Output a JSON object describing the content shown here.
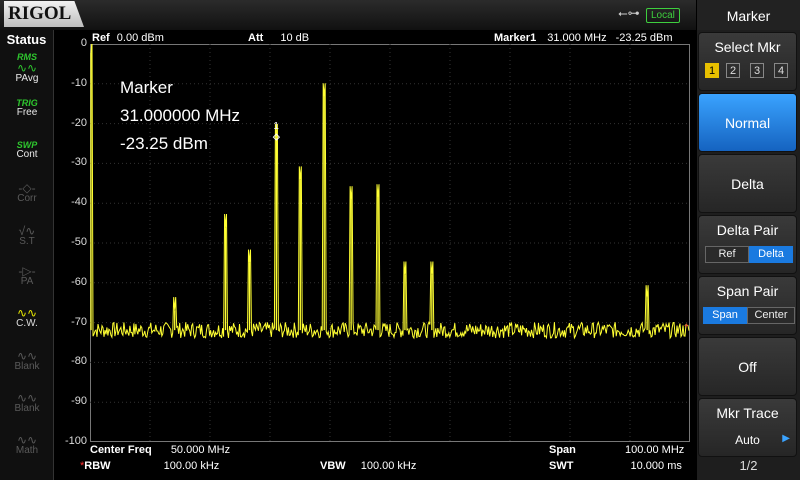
{
  "brand": "RIGOL",
  "remote": "Local",
  "status": {
    "title": "Status",
    "icons": [
      {
        "name": "average-icon",
        "top": "RMS",
        "wave": "∿∿",
        "label": "PAvg",
        "state": "on"
      },
      {
        "name": "trigger-icon",
        "top": "TRIG",
        "wave": "",
        "label": "Free",
        "state": "on"
      },
      {
        "name": "sweep-icon",
        "top": "SWP",
        "wave": "",
        "label": "Cont",
        "state": "on"
      },
      {
        "name": "correction-icon",
        "top": "",
        "wave": "-◇-",
        "label": "Corr",
        "state": "off"
      },
      {
        "name": "source-tracking-icon",
        "top": "",
        "wave": "√∿",
        "label": "S.T",
        "state": "off"
      },
      {
        "name": "preamp-icon",
        "top": "",
        "wave": "-▷-",
        "label": "PA",
        "state": "off"
      },
      {
        "name": "clear-write-icon",
        "top": "",
        "wave": "∿∿",
        "label": "C.W.",
        "state": "on"
      },
      {
        "name": "blank-icon",
        "top": "",
        "wave": "∿∿",
        "label": "Blank",
        "state": "off"
      },
      {
        "name": "blank-icon-2",
        "top": "",
        "wave": "∿∿",
        "label": "Blank",
        "state": "off"
      },
      {
        "name": "math-icon",
        "top": "",
        "wave": "∿∿",
        "label": "Math",
        "state": "off"
      }
    ]
  },
  "header": {
    "ref_label": "Ref",
    "ref_value": "0.00 dBm",
    "att_label": "Att",
    "att_value": "10 dB",
    "marker_label": "Marker1",
    "marker_freq": "31.000 MHz",
    "marker_amp": "-23.25 dBm"
  },
  "marker_box": {
    "title": "Marker",
    "freq": "31.000000 MHz",
    "amp": "-23.25 dBm",
    "tag": "1"
  },
  "footer": {
    "center_label": "Center Freq",
    "center_value": "50.000 MHz",
    "span_label": "Span",
    "span_value": "100.00 MHz",
    "rbw_star": "*",
    "rbw_label": "RBW",
    "rbw_value": "100.00 kHz",
    "vbw_label": "VBW",
    "vbw_value": "100.00 kHz",
    "swt_label": "SWT",
    "swt_value": "10.000 ms"
  },
  "softkeys": {
    "menu_title": "Marker",
    "select_mkr": {
      "label": "Select Mkr",
      "options": [
        "1",
        "2",
        "3",
        "4"
      ],
      "selected": "1"
    },
    "normal": "Normal",
    "delta": "Delta",
    "delta_pair": {
      "label": "Delta Pair",
      "options": [
        "Ref",
        "Delta"
      ],
      "selected": "Delta"
    },
    "span_pair": {
      "label": "Span Pair",
      "options": [
        "Span",
        "Center"
      ],
      "selected": "Span"
    },
    "off": "Off",
    "mkr_trace": {
      "label": "Mkr Trace",
      "value": "Auto"
    },
    "page": "1/2"
  },
  "chart_data": {
    "type": "line",
    "title": "",
    "xlabel": "",
    "ylabel": "",
    "x_unit": "MHz",
    "y_unit": "dBm",
    "xlim": [
      0,
      100
    ],
    "ylim": [
      -100,
      0
    ],
    "y_ticks": [
      "0",
      "-10",
      "-20",
      "-30",
      "-40",
      "-50",
      "-60",
      "-70",
      "-80",
      "-90",
      "-100"
    ],
    "noise_floor": -72,
    "color": "#ffff33",
    "peaks": [
      {
        "x": 0.0,
        "y": -2
      },
      {
        "x": 14.0,
        "y": -67
      },
      {
        "x": 22.5,
        "y": -46
      },
      {
        "x": 26.5,
        "y": -55
      },
      {
        "x": 31.0,
        "y": -23.25
      },
      {
        "x": 35.0,
        "y": -34
      },
      {
        "x": 39.0,
        "y": -13
      },
      {
        "x": 43.5,
        "y": -39
      },
      {
        "x": 48.0,
        "y": -38.5
      },
      {
        "x": 52.5,
        "y": -58
      },
      {
        "x": 57.0,
        "y": -58
      },
      {
        "x": 93.0,
        "y": -64
      }
    ],
    "marker": {
      "x": 31.0,
      "y": -23.25
    }
  }
}
